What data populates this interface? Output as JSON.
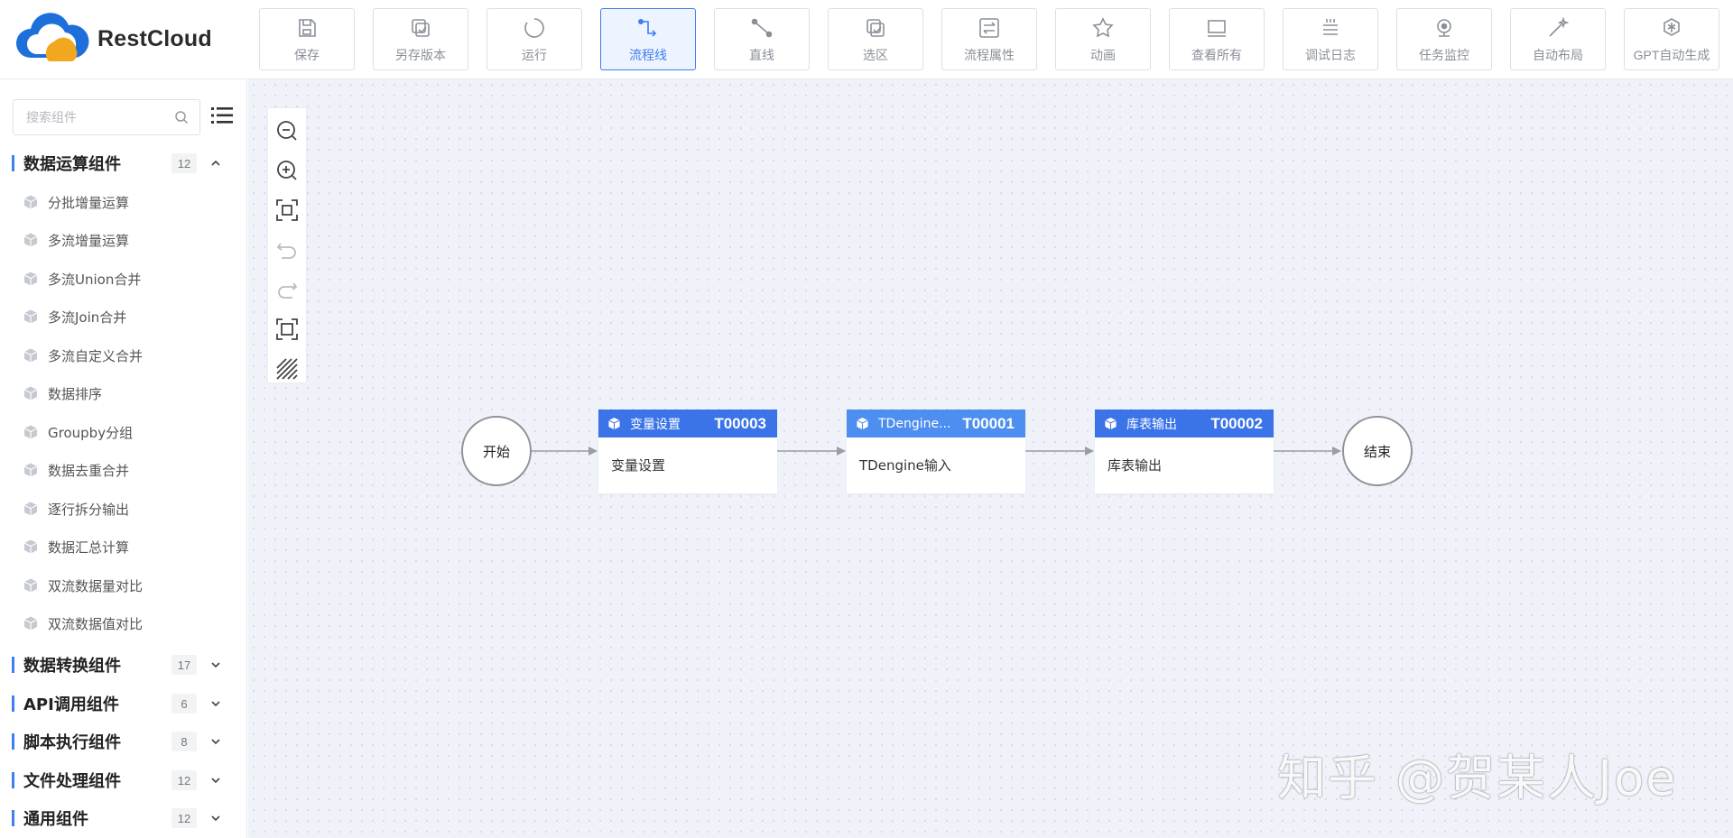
{
  "app": {
    "name": "RestCloud"
  },
  "toolbar": {
    "buttons": [
      {
        "label": "保存",
        "icon": "save-icon"
      },
      {
        "label": "另存版本",
        "icon": "copy-version-icon"
      },
      {
        "label": "运行",
        "icon": "run-icon"
      },
      {
        "label": "流程线",
        "icon": "polyline-icon",
        "active": true
      },
      {
        "label": "直线",
        "icon": "line-icon"
      },
      {
        "label": "选区",
        "icon": "selection-icon"
      },
      {
        "label": "流程属性",
        "icon": "properties-icon"
      },
      {
        "label": "动画",
        "icon": "animation-icon"
      },
      {
        "label": "查看所有",
        "icon": "view-all-icon"
      },
      {
        "label": "调试日志",
        "icon": "debug-log-icon"
      },
      {
        "label": "任务监控",
        "icon": "monitor-icon"
      },
      {
        "label": "自动布局",
        "icon": "auto-layout-icon"
      },
      {
        "label": "GPT自动生成",
        "icon": "gpt-icon"
      }
    ]
  },
  "sidebar": {
    "search": {
      "placeholder": "搜索组件"
    },
    "categories": [
      {
        "name": "数据运算组件",
        "count": "12",
        "expanded": true,
        "items": [
          "分批增量运算",
          "多流增量运算",
          "多流Union合并",
          "多流Join合并",
          "多流自定义合并",
          "数据排序",
          "Groupby分组",
          "数据去重合并",
          "逐行拆分输出",
          "数据汇总计算",
          "双流数据量对比",
          "双流数据值对比"
        ]
      },
      {
        "name": "数据转换组件",
        "count": "17",
        "expanded": false
      },
      {
        "name": "API调用组件",
        "count": "6",
        "expanded": false
      },
      {
        "name": "脚本执行组件",
        "count": "8",
        "expanded": false
      },
      {
        "name": "文件处理组件",
        "count": "12",
        "expanded": false
      },
      {
        "name": "通用组件",
        "count": "12",
        "expanded": false
      }
    ]
  },
  "flow": {
    "start": {
      "label": "开始"
    },
    "end": {
      "label": "结束"
    },
    "tasks": [
      {
        "title": "变量设置",
        "id": "T00003",
        "body": "变量设置",
        "header_color": "#3b73e8"
      },
      {
        "title": "TDengine...",
        "id": "T00001",
        "body": "TDengine输入",
        "header_color": "#4d8ef0"
      },
      {
        "title": "库表输出",
        "id": "T00002",
        "body": "库表输出",
        "header_color": "#3b73e8"
      }
    ]
  },
  "watermark": "知乎 @贺某人Joe",
  "colors": {
    "accent": "#3f7ef0",
    "canvas_bg": "#f0f2fa",
    "edge": "#9a9da3"
  }
}
